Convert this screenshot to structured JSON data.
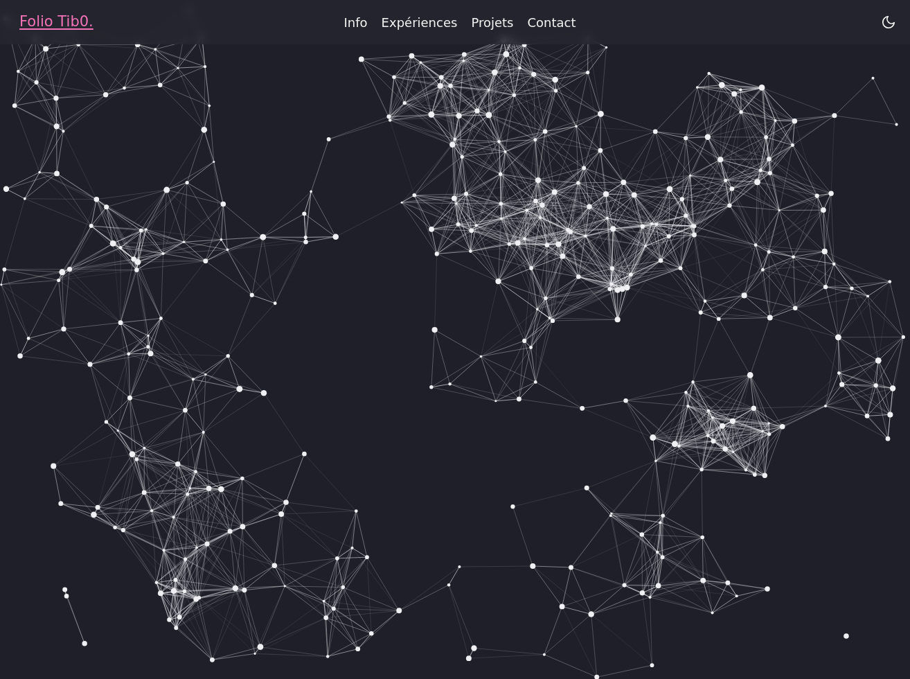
{
  "navbar": {
    "brand": "Folio Tib0.",
    "links": [
      {
        "label": "Info"
      },
      {
        "label": "Expériences"
      },
      {
        "label": "Projets"
      },
      {
        "label": "Contact"
      }
    ]
  }
}
